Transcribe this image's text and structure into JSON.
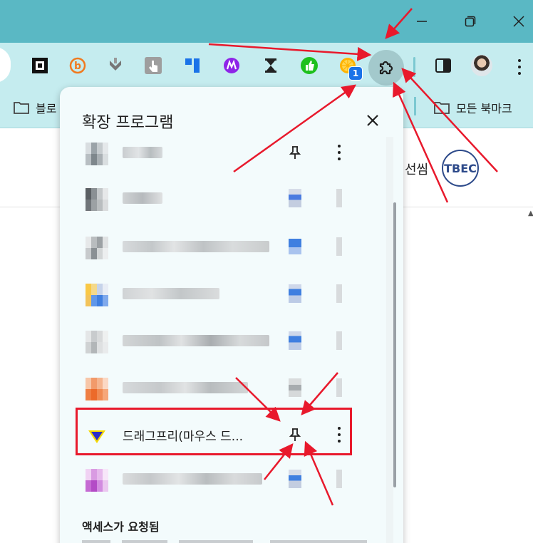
{
  "window": {
    "controls": [
      {
        "name": "minimize-button",
        "icon": "minimize-icon"
      },
      {
        "name": "restore-button",
        "icon": "restore-icon"
      },
      {
        "name": "close-window-button",
        "icon": "close-icon"
      }
    ]
  },
  "toolbar": {
    "extension_icons": [
      {
        "name": "square-logo-icon"
      },
      {
        "name": "b-circle-icon"
      },
      {
        "name": "download-arrow-icon"
      },
      {
        "name": "touch-hand-icon"
      },
      {
        "name": "blue-bars-icon"
      },
      {
        "name": "purple-m-icon"
      },
      {
        "name": "hourglass-icon"
      },
      {
        "name": "green-thumb-icon"
      },
      {
        "name": "orange-slice-icon"
      }
    ],
    "badge_count": "1",
    "puzzle_icon": "puzzle-icon"
  },
  "bookmarks": {
    "left_folder_label": "블로",
    "right_folder_label": "모든 북마크"
  },
  "page": {
    "partial_text": "선씸",
    "logo_text": "TBEC"
  },
  "panel": {
    "title": "확장 프로그램",
    "visible_extension": {
      "name": "드래그프리(마우스 드...",
      "icon": "download-down-arrow-icon"
    },
    "section_title": "액세스가 요청됨"
  },
  "colors": {
    "titlebar": "#5ab8c4",
    "toolbar": "#c5ecef",
    "panel": "#f3fbfc",
    "highlight": "#e8192c",
    "badge": "#1a73e8"
  }
}
